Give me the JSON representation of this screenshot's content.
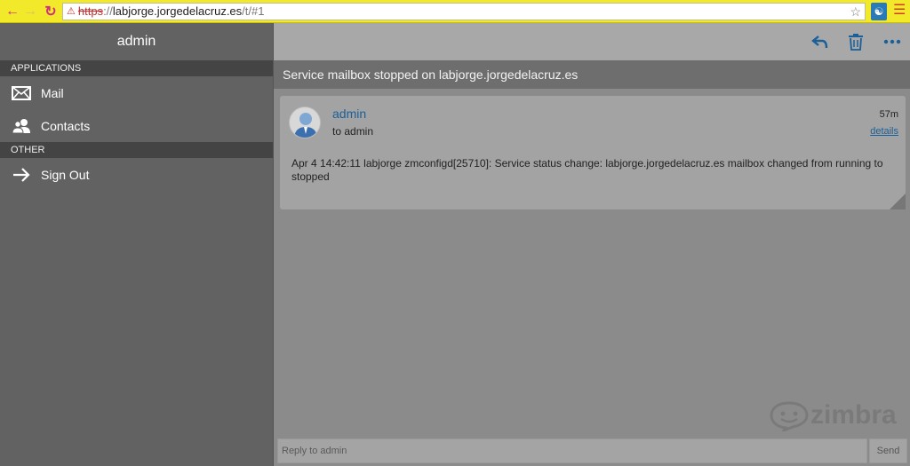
{
  "browser": {
    "url_scheme": "https",
    "url_sep": "://",
    "url_host": "labjorge.jorgedelacruz.es",
    "url_path": "/t/#1",
    "back_icon": "back-arrow-icon",
    "forward_icon": "forward-arrow-icon",
    "reload_icon": "reload-icon",
    "bookmark_icon": "star-icon",
    "menu_icon": "hamburger-menu-icon"
  },
  "sidebar": {
    "user": "admin",
    "sections": [
      {
        "header": "APPLICATIONS",
        "items": [
          {
            "label": "Mail",
            "icon": "mail-icon"
          },
          {
            "label": "Contacts",
            "icon": "contacts-icon"
          }
        ]
      },
      {
        "header": "OTHER",
        "items": [
          {
            "label": "Sign Out",
            "icon": "arrow-right-icon"
          }
        ]
      }
    ]
  },
  "toolbar": {
    "reply_icon": "reply-icon",
    "delete_icon": "trash-icon",
    "more_icon": "more-dots-icon"
  },
  "message": {
    "subject": "Service mailbox stopped on labjorge.jorgedelacruz.es",
    "sender": "admin",
    "to": "to admin",
    "time": "57m",
    "details_link": "details",
    "body": "Apr  4 14:42:11 labjorge zmconfigd[25710]: Service status change: labjorge.jorgedelacruz.es mailbox changed from running to stopped"
  },
  "branding": {
    "logo": "zimbra"
  },
  "reply": {
    "placeholder": "Reply to admin",
    "send_label": "Send"
  },
  "colors": {
    "browser_bar": "#f2e92a",
    "sidebar": "#626262",
    "link": "#1a5f98",
    "toolbar_icon": "#1a5f98"
  }
}
